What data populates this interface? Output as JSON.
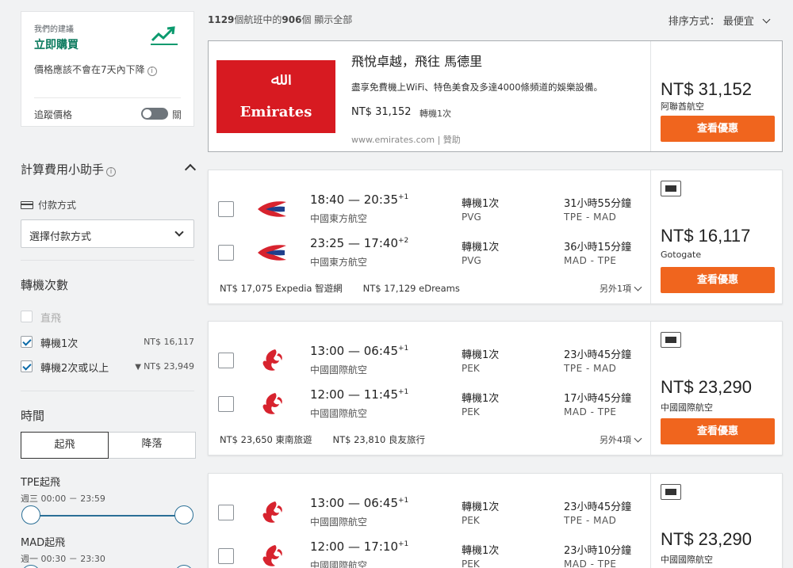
{
  "price_alert": {
    "small_label": "我們的建議",
    "title": "立即購買",
    "desc": "價格應該不會在7天內下降",
    "info": "i",
    "track_label": "追蹤價格",
    "toggle_state": "關"
  },
  "fee_helper": {
    "title": "計算費用小助手",
    "info": "i",
    "pay_label": "付款方式",
    "pay_select": "選擇付款方式"
  },
  "stops_filter": {
    "title": "轉機次數",
    "options": [
      {
        "label": "直飛",
        "price": "",
        "checked": false,
        "disabled": true
      },
      {
        "label": "轉機1次",
        "price": "NT$ 16,117",
        "checked": true,
        "disabled": false
      },
      {
        "label": "轉機2次或以上",
        "price": "NT$ 23,949",
        "checked": true,
        "disabled": false
      }
    ]
  },
  "time_filter": {
    "title": "時間",
    "tab_depart": "起飛",
    "tab_land": "降落",
    "tpe_label": "TPE起飛",
    "tpe_range": "週三 00:00 － 23:59",
    "mad_label": "MAD起飛",
    "mad_range": "週一 00:30 － 23:30"
  },
  "results": {
    "count_total": "1129",
    "count_shown": "906",
    "count_text_1": "個航班中的",
    "count_text_2": "個 顯示全部",
    "sort_label": "排序方式：",
    "sort_value": "最便宜"
  },
  "ad": {
    "logo_text": "Emirates",
    "logo_script": "ﷲ",
    "title": "飛悅卓越，飛往 馬德里",
    "desc": "盡享免費機上WiFi、特色美食及多達4000條頻道的娛樂設備。",
    "price": "NT$ 31,152",
    "stops": "轉機1次",
    "url": "www.emirates.com | 贊助",
    "price_big": "NT$ 31,152",
    "provider": "阿聯酋航空",
    "cta": "查看優惠"
  },
  "cards": [
    {
      "legs": [
        {
          "times": "18:40 — 20:35",
          "plus": "+1",
          "airline": "中國東方航空",
          "stops": "轉機1次",
          "via": "PVG",
          "duration": "31小時55分鐘",
          "route": "TPE - MAD",
          "logo": "china-eastern"
        },
        {
          "times": "23:25 — 17:40",
          "plus": "+2",
          "airline": "中國東方航空",
          "stops": "轉機1次",
          "via": "PVG",
          "duration": "36小時15分鐘",
          "route": "MAD - TPE",
          "logo": "china-eastern"
        }
      ],
      "other_prices": [
        "NT$ 17,075 Expedia 智遊網",
        "NT$ 17,129 eDreams"
      ],
      "more": "另外1項",
      "price": "NT$ 16,117",
      "provider": "Gotogate",
      "cta": "查看優惠"
    },
    {
      "legs": [
        {
          "times": "13:00 — 06:45",
          "plus": "+1",
          "airline": "中國國際航空",
          "stops": "轉機1次",
          "via": "PEK",
          "duration": "23小時45分鐘",
          "route": "TPE - MAD",
          "logo": "air-china"
        },
        {
          "times": "12:00 — 11:45",
          "plus": "+1",
          "airline": "中國國際航空",
          "stops": "轉機1次",
          "via": "PEK",
          "duration": "17小時45分鐘",
          "route": "MAD - TPE",
          "logo": "air-china"
        }
      ],
      "other_prices": [
        "NT$ 23,650 東南旅遊",
        "NT$ 23,810 良友旅行"
      ],
      "more": "另外4項",
      "price": "NT$ 23,290",
      "provider": "中國國際航空",
      "cta": "查看優惠"
    },
    {
      "legs": [
        {
          "times": "13:00 — 06:45",
          "plus": "+1",
          "airline": "中國國際航空",
          "stops": "轉機1次",
          "via": "PEK",
          "duration": "23小時45分鐘",
          "route": "TPE - MAD",
          "logo": "air-china"
        },
        {
          "times": "12:00 — 17:10",
          "plus": "+1",
          "airline": "中國國際航空",
          "stops": "轉機1次",
          "via": "PEK",
          "duration": "23小時10分鐘",
          "route": "MAD - TPE",
          "logo": "air-china"
        }
      ],
      "price": "NT$ 23,290",
      "provider": "中國國際航空"
    }
  ],
  "colors": {
    "accent_green": "#0b7a5e",
    "cta_orange": "#f0651e",
    "emirates_red": "#d71a21",
    "airline_red": "#d7232e",
    "slider_blue": "#2a6f96"
  }
}
